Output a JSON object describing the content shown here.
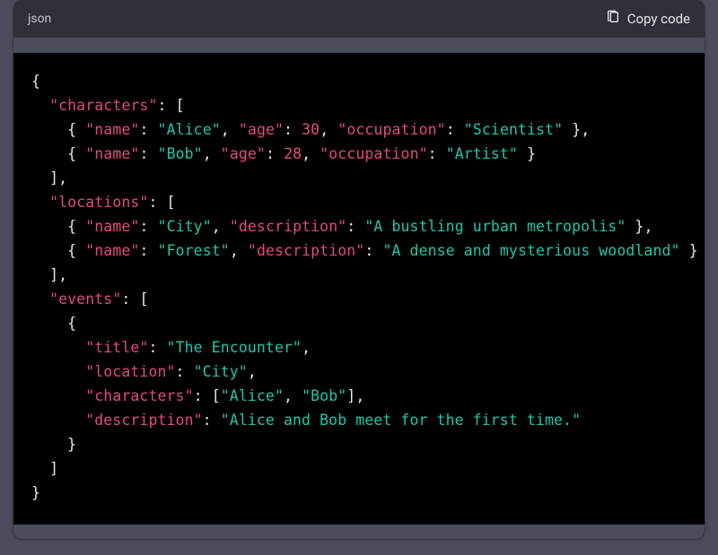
{
  "header": {
    "language_label": "json",
    "copy_label": "Copy code"
  },
  "code": {
    "value": "{\n  \"characters\": [\n    { \"name\": \"Alice\", \"age\": 30, \"occupation\": \"Scientist\" },\n    { \"name\": \"Bob\", \"age\": 28, \"occupation\": \"Artist\" }\n  ],\n  \"locations\": [\n    { \"name\": \"City\", \"description\": \"A bustling urban metropolis\" },\n    { \"name\": \"Forest\", \"description\": \"A dense and mysterious woodland\" }\n  ],\n  \"events\": [\n    {\n      \"title\": \"The Encounter\",\n      \"location\": \"City\",\n      \"characters\": [\"Alice\", \"Bob\"],\n      \"description\": \"Alice and Bob meet for the first time.\"\n    }\n  ]\n}"
  },
  "code_json": {
    "characters": [
      {
        "name": "Alice",
        "age": 30,
        "occupation": "Scientist"
      },
      {
        "name": "Bob",
        "age": 28,
        "occupation": "Artist"
      }
    ],
    "locations": [
      {
        "name": "City",
        "description": "A bustling urban metropolis"
      },
      {
        "name": "Forest",
        "description": "A dense and mysterious woodland"
      }
    ],
    "events": [
      {
        "title": "The Encounter",
        "location": "City",
        "characters": [
          "Alice",
          "Bob"
        ],
        "description": "Alice and Bob meet for the first time."
      }
    ]
  }
}
